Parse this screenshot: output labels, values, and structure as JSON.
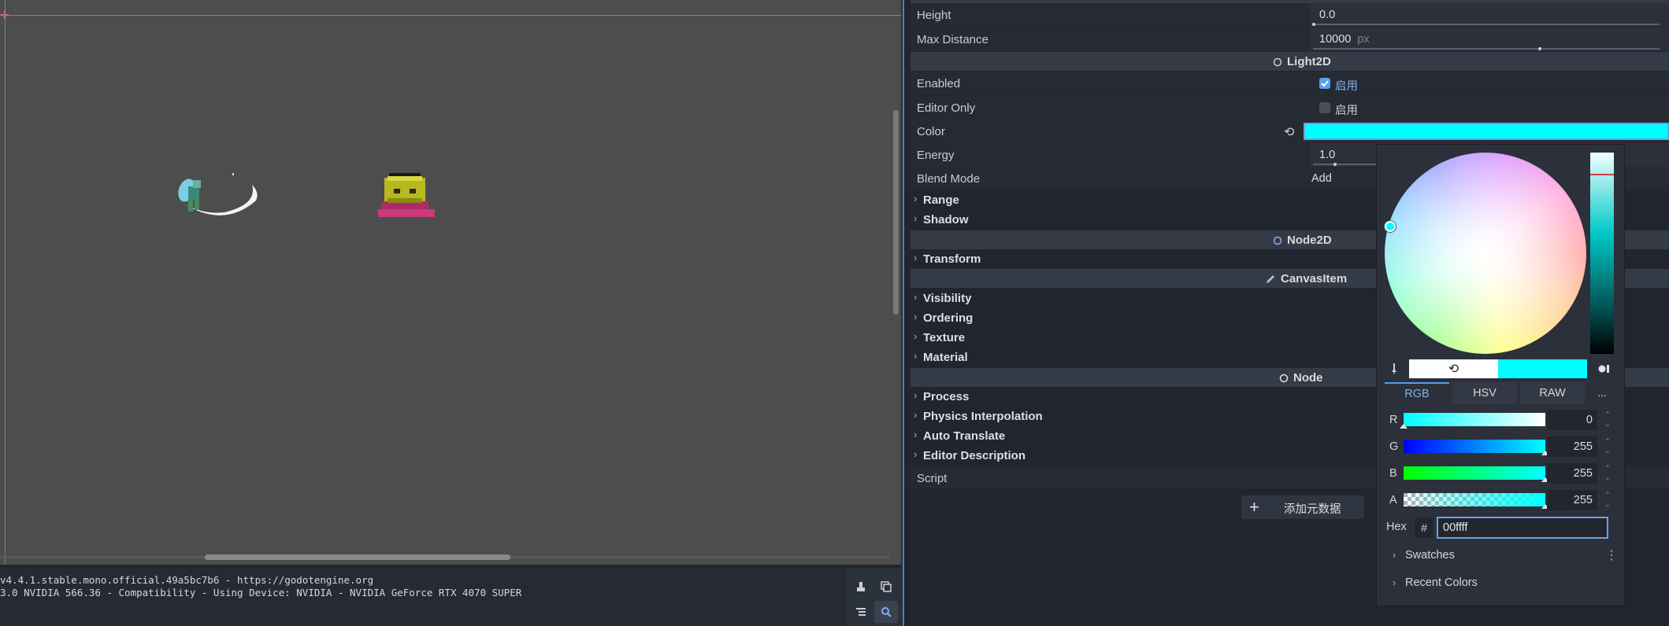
{
  "viewport": {
    "origin_marker": "✛"
  },
  "output": {
    "lines": [
      "v4.4.1.stable.mono.official.49a5bc7b6 - https://godotengine.org",
      "3.0 NVIDIA 566.36 - Compatibility - Using Device: NVIDIA - NVIDIA GeForce RTX 4070 SUPER"
    ],
    "tools": [
      "clear-icon",
      "copy-icon",
      "filter-icon",
      "search-icon"
    ]
  },
  "inspector": {
    "height": {
      "label": "Height",
      "value": "0.0"
    },
    "max_distance": {
      "label": "Max Distance",
      "value": "10000",
      "unit": "px"
    },
    "light2d_section": "Light2D",
    "enabled": {
      "label": "Enabled",
      "checkbox_label": "启用",
      "checked": true
    },
    "editor_only": {
      "label": "Editor Only",
      "checkbox_label": "启用",
      "checked": false
    },
    "color": {
      "label": "Color",
      "value": "#00ffff"
    },
    "energy": {
      "label": "Energy",
      "value": "1.0"
    },
    "blend_mode": {
      "label": "Blend Mode",
      "value": "Add"
    },
    "groups_light": [
      "Range",
      "Shadow"
    ],
    "node2d_section": "Node2D",
    "groups_node2d": [
      "Transform"
    ],
    "canvasitem_section": "CanvasItem",
    "groups_canvas": [
      "Visibility",
      "Ordering",
      "Texture",
      "Material"
    ],
    "node_section": "Node",
    "groups_node": [
      "Process",
      "Physics Interpolation",
      "Auto Translate",
      "Editor Description"
    ],
    "script": {
      "label": "Script"
    },
    "add_metadata": "添加元数据"
  },
  "color_picker": {
    "modes": [
      "RGB",
      "HSV",
      "RAW",
      "..."
    ],
    "active_mode": "RGB",
    "channels": [
      {
        "name": "R",
        "value": "0"
      },
      {
        "name": "G",
        "value": "255"
      },
      {
        "name": "B",
        "value": "255"
      },
      {
        "name": "A",
        "value": "255"
      }
    ],
    "hex_label": "Hex",
    "hex_hash": "#",
    "hex_value": "00ffff",
    "swatches": "Swatches",
    "recent_colors": "Recent Colors",
    "old_color": "#ffffff",
    "new_color": "#00ffff"
  },
  "colors": {
    "accent": "#5a9ae8",
    "picked": "#00ffff"
  }
}
